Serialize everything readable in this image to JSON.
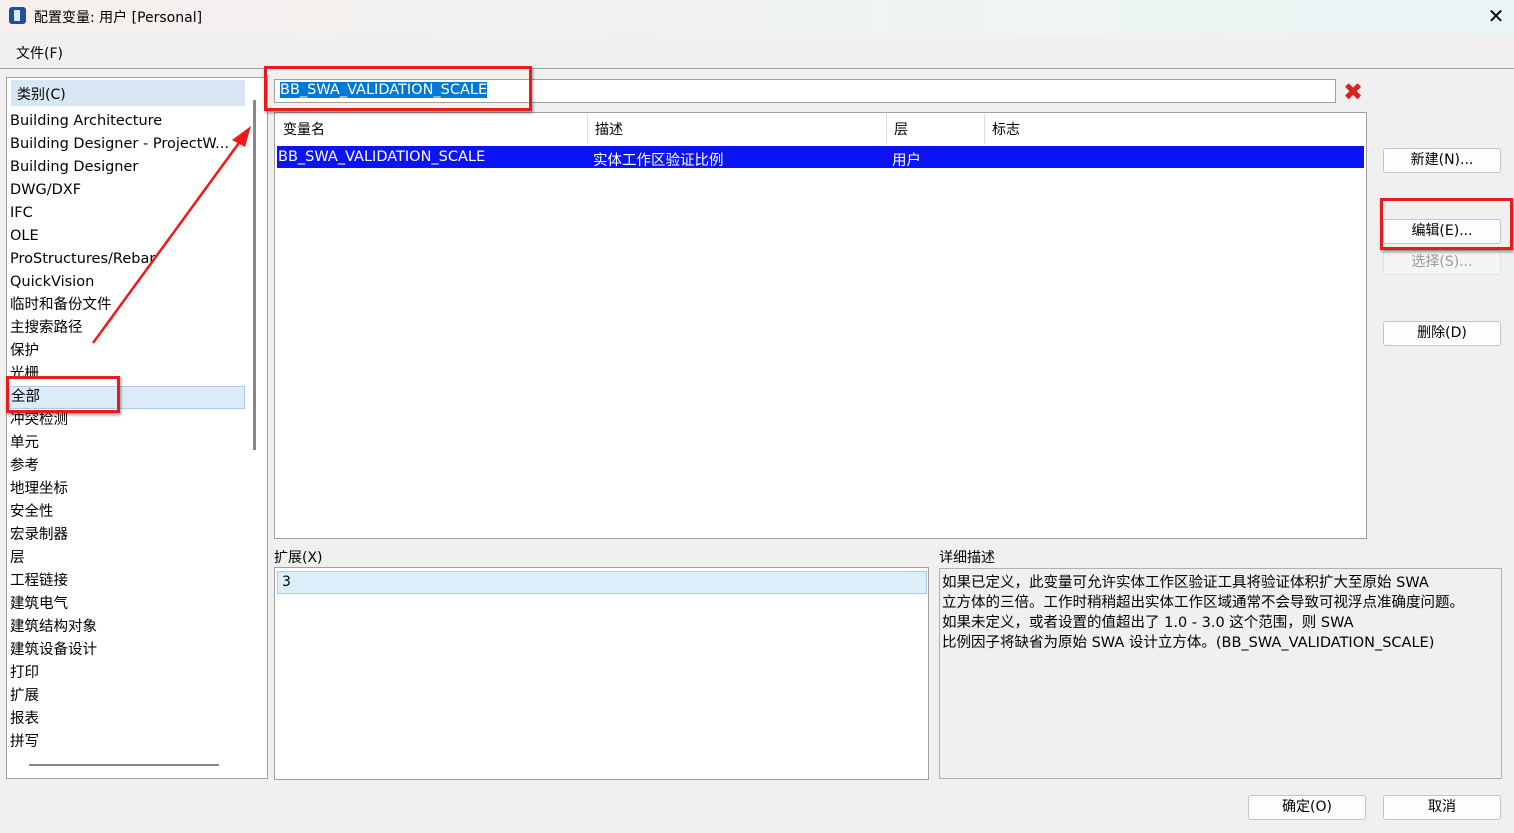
{
  "window": {
    "title": "配置变量: 用户 [Personal]",
    "close_icon": "close-icon"
  },
  "menu": {
    "file": "文件(F)"
  },
  "categories": {
    "header": "类别(C)",
    "items": [
      "Building Architecture",
      "Building Designer - ProjectW...",
      "Building Designer",
      "DWG/DXF",
      "IFC",
      "OLE",
      "ProStructures/Rebar",
      "QuickVision",
      "临时和备份文件",
      "主搜索路径",
      "保护",
      "光栅",
      "全部",
      "冲突检测",
      "单元",
      "参考",
      "地理坐标",
      "安全性",
      "宏录制器",
      "层",
      "工程链接",
      "建筑电气",
      "建筑结构对象",
      "建筑设备设计",
      "打印",
      "扩展",
      "报表",
      "拼写"
    ],
    "selected": "全部"
  },
  "filter": {
    "value": "BB_SWA_VALIDATION_SCALE"
  },
  "grid": {
    "columns": [
      "变量名",
      "描述",
      "层",
      "标志"
    ],
    "rows": [
      {
        "name": "BB_SWA_VALIDATION_SCALE",
        "desc": "实体工作区验证比例",
        "level": "用户",
        "flags": ""
      }
    ]
  },
  "buttons": {
    "new": "新建(N)...",
    "edit": "编辑(E)...",
    "select": "选择(S)...",
    "delete": "删除(D)",
    "ok": "确定(O)",
    "cancel": "取消"
  },
  "expansion": {
    "label": "扩展(X)",
    "value": "3"
  },
  "details": {
    "label": "详细描述",
    "lines": [
      "如果已定义，此变量可允许实体工作区验证工具将验证体积扩大至原始 SWA",
      "立方体的三倍。工作时稍稍超出实体工作区域通常不会导致可视浮点准确度问题。",
      "如果未定义，或者设置的值超出了 1.0 - 3.0 这个范围，则 SWA",
      "比例因子将缺省为原始 SWA 设计立方体。(BB_SWA_VALIDATION_SCALE)"
    ]
  }
}
